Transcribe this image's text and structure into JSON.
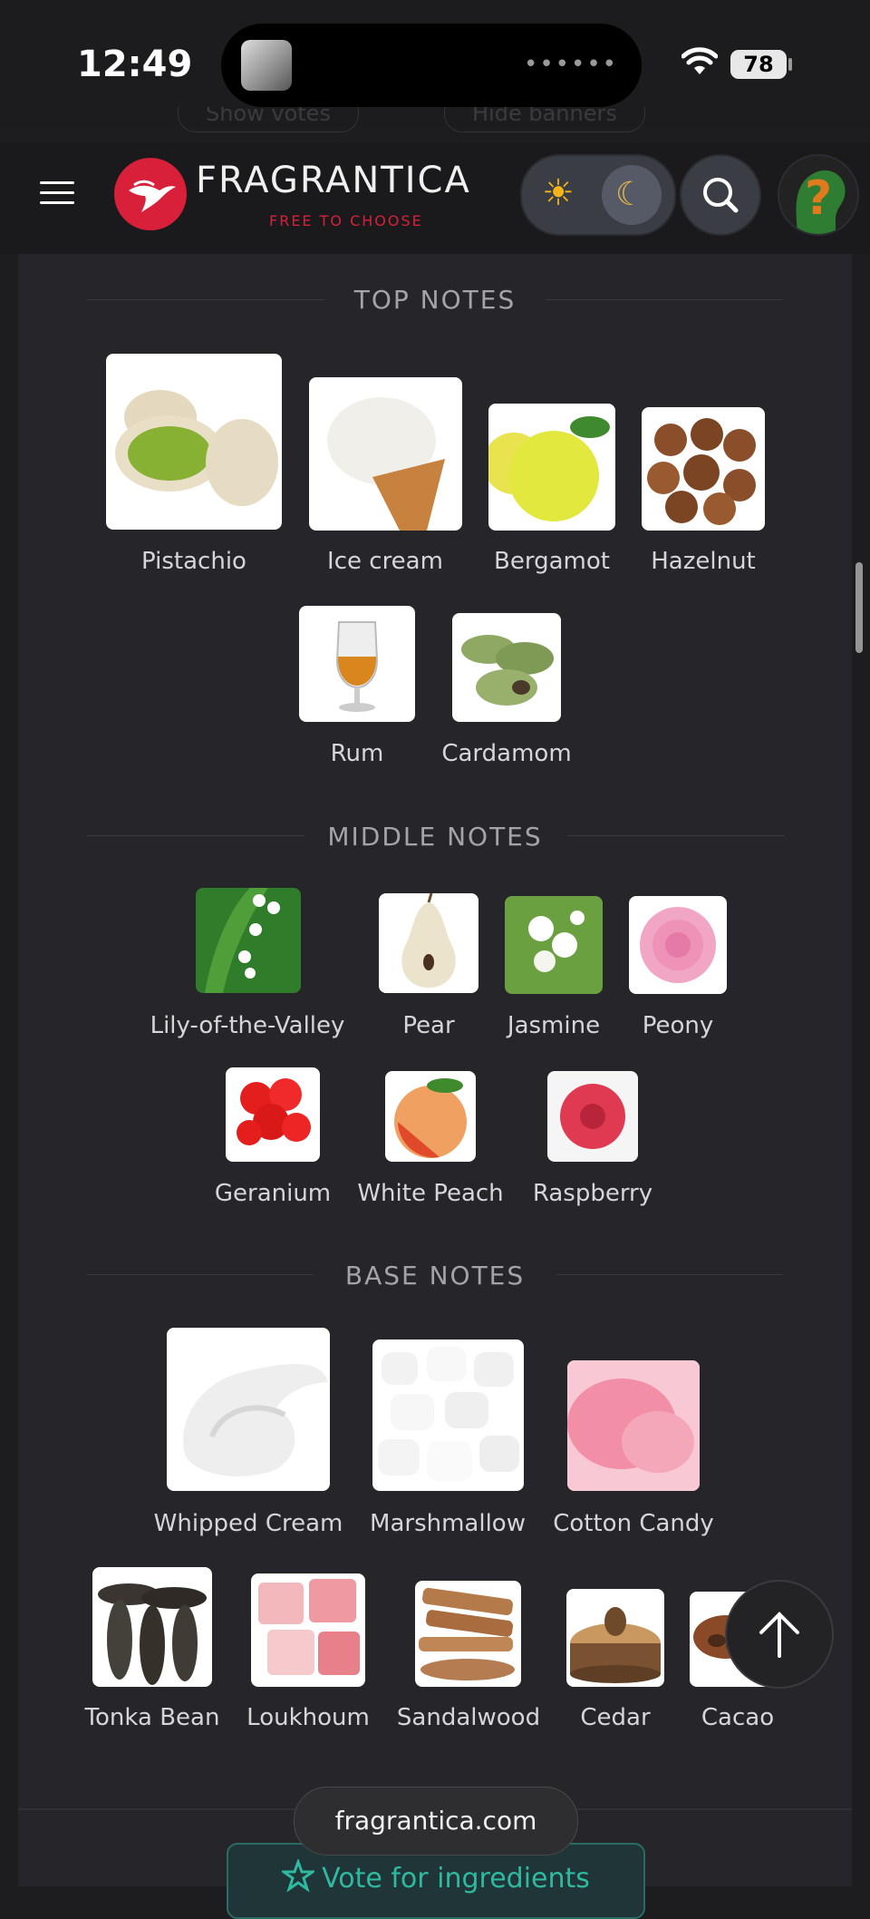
{
  "status_bar": {
    "time": "12:49",
    "battery": "78"
  },
  "hidden_pills": [
    "Show votes",
    "Hide banners"
  ],
  "header": {
    "brand": "FRAGRANTICA",
    "tagline": "FREE TO CHOOSE"
  },
  "sections": {
    "top": {
      "title": "TOP NOTES",
      "notes": [
        "Pistachio",
        "Ice cream",
        "Bergamot",
        "Hazelnut",
        "Rum",
        "Cardamom"
      ]
    },
    "middle": {
      "title": "MIDDLE NOTES",
      "notes": [
        "Lily-of-the-Valley",
        "Pear",
        "Jasmine",
        "Peony",
        "Geranium",
        "White Peach",
        "Raspberry"
      ]
    },
    "base": {
      "title": "BASE NOTES",
      "notes": [
        "Whipped Cream",
        "Marshmallow",
        "Cotton Candy",
        "Tonka Bean",
        "Loukhoum",
        "Sandalwood",
        "Cedar",
        "Cacao"
      ]
    }
  },
  "footer": {
    "url": "fragrantica.com",
    "vote_button": "Vote for ingredients"
  },
  "colors": {
    "accent_red": "#d8203a",
    "teal": "#2fb9a1",
    "background": "#1d1d20"
  }
}
